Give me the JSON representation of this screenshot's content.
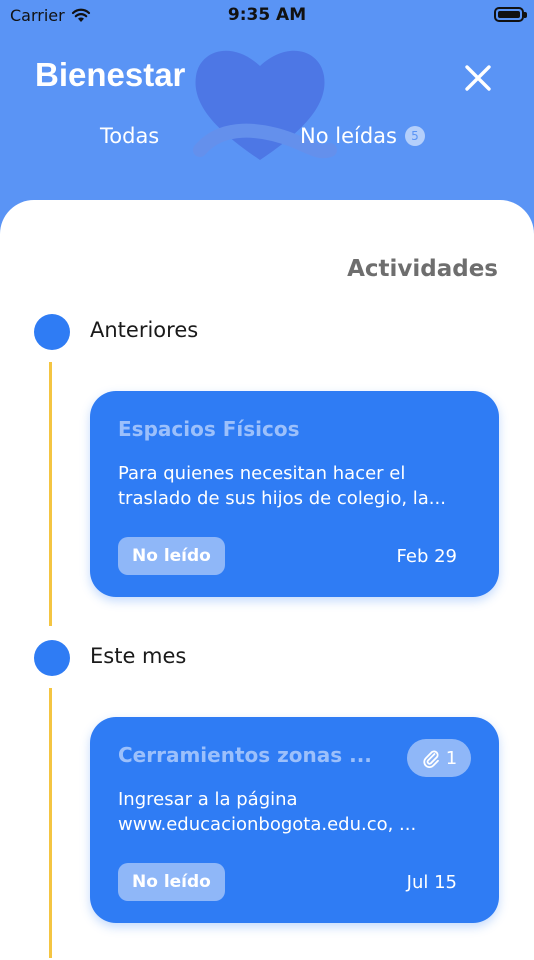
{
  "status_bar": {
    "carrier": "Carrier",
    "time": "9:35 AM"
  },
  "header": {
    "title": "Bienestar"
  },
  "tabs": [
    {
      "label": "Todas"
    },
    {
      "label": "No leídas",
      "badge": "5"
    }
  ],
  "section": {
    "title": "Actividades"
  },
  "groups": [
    {
      "label": "Anteriores",
      "card": {
        "title": "Espacios Físicos",
        "body_line1": "Para quienes necesitan hacer el",
        "body_line2": "traslado de sus hijos de colegio, la...",
        "status": "No leído",
        "date": "Feb 29"
      }
    },
    {
      "label": "Este mes",
      "card": {
        "title": "Cerramientos zonas ...",
        "attachments": "1",
        "body_line1": "Ingresar a la página",
        "body_line2": "www.educacionbogota.edu.co, ...",
        "status": "No leído",
        "date": "Jul 15"
      }
    }
  ],
  "colors": {
    "primary": "#2f7cf4",
    "header_bg": "#5a94f5",
    "timeline": "#f4c542"
  }
}
